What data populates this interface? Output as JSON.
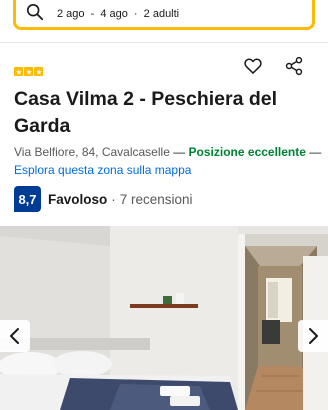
{
  "search": {
    "checkin": "2 ago",
    "separator1": "-",
    "checkout": "4 ago",
    "dot": "·",
    "guests": "2 adulti"
  },
  "property": {
    "stars_count": 3,
    "star_color": "#febb02",
    "title": "Casa Vilma 2 - Peschiera del Garda",
    "address": "Via Belfiore, 84, Cavalcaselle",
    "dash1": " — ",
    "location_label": "Posizione eccellente",
    "dash2": " —",
    "map_link": "Esplora questa zona sulla mappa"
  },
  "rating": {
    "score": "8,7",
    "word": "Favoloso",
    "separator": "·",
    "reviews": "7 recensioni",
    "badge_color": "#003b95"
  },
  "icons": {
    "search": "search-icon",
    "favorite": "heart-icon",
    "share": "share-icon",
    "prev": "chevron-left-icon",
    "next": "chevron-right-icon"
  },
  "colors": {
    "accent": "#febb02",
    "link": "#006ce4",
    "positive": "#008234"
  }
}
